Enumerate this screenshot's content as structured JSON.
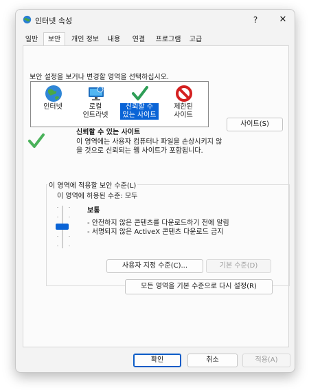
{
  "window": {
    "title": "인터넷 속성",
    "help": "?",
    "close": "✕"
  },
  "tabs": [
    {
      "label": "일반",
      "active": false
    },
    {
      "label": "보안",
      "active": true
    },
    {
      "label": "개인 정보",
      "active": false
    },
    {
      "label": "내용",
      "active": false
    },
    {
      "label": "연결",
      "active": false
    },
    {
      "label": "프로그램",
      "active": false
    },
    {
      "label": "고급",
      "active": false
    }
  ],
  "security": {
    "prompt": "보안 설정을 보거나 변경할 영역을 선택하십시오.",
    "zones": [
      {
        "label": "인터넷",
        "icon": "globe-icon",
        "selected": false
      },
      {
        "label": "로컬\n인트라넷",
        "icon": "monitor-icon",
        "selected": false
      },
      {
        "label": "신뢰할 수\n있는 사이트",
        "icon": "checkmark-icon",
        "selected": true
      },
      {
        "label": "제한된\n사이트",
        "icon": "no-entry-icon",
        "selected": false
      }
    ],
    "selected_zone_title": "신뢰할 수 있는 사이트",
    "selected_zone_description": "이 영역에는 사용자 컴퓨터나 파일을 손상시키지 않\n을 것으로 신뢰되는 웹 사이트가 포함됩니다.",
    "sites_button": "사이트(S)",
    "level_group_label": "이 영역에 적용할 보안 수준(L)",
    "allowed_levels": "이 영역에 허용된 수준: 모두",
    "level_name": "보통",
    "level_description": "- 안전하지 않은 콘텐츠를 다운로드하기 전에 알림\n- 서명되지 않은 ActiveX 콘텐츠 다운로드 금지",
    "slider": {
      "position": 3,
      "max": 5
    },
    "custom_level_button": "사용자 지정 수준(C)...",
    "default_level_button": "기본 수준(D)",
    "reset_all_button": "모든 영역을 기본 수준으로 다시 설정(R)"
  },
  "footer": {
    "ok": "확인",
    "cancel": "취소",
    "apply": "적용(A)"
  },
  "colors": {
    "accent": "#0a64d6",
    "check_green": "#2f9e57",
    "restricted_red": "#d42020"
  }
}
